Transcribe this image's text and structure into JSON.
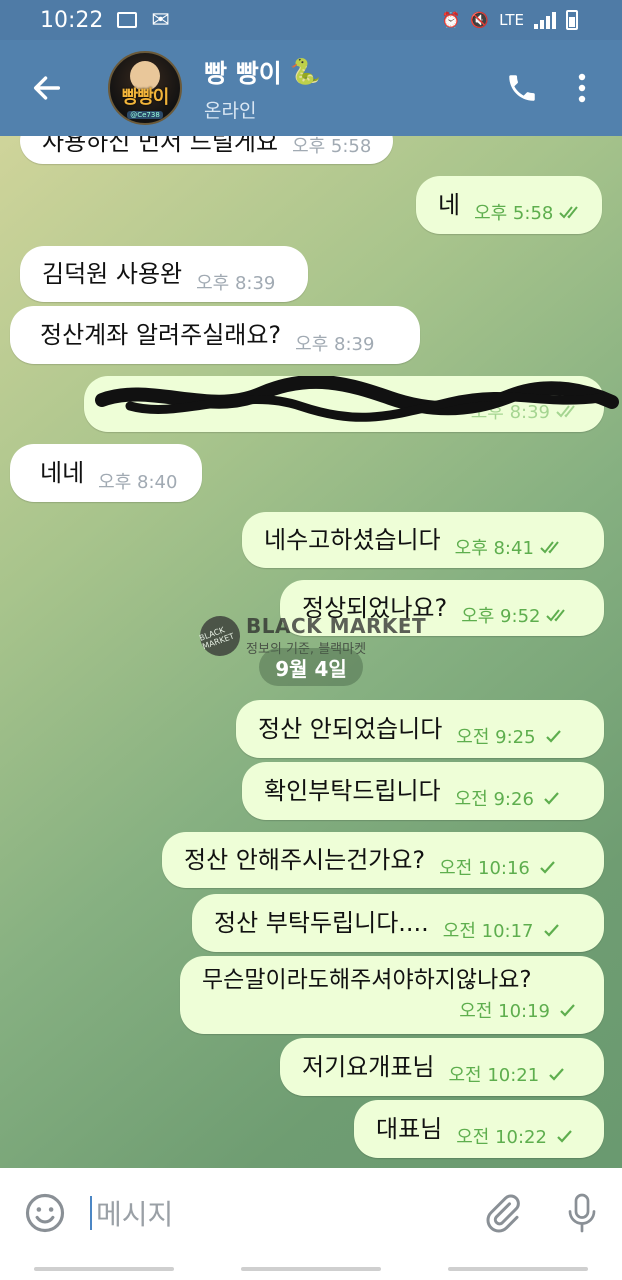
{
  "status_bar": {
    "time": "10:22",
    "network": "LTE"
  },
  "header": {
    "title": "빵 빵이",
    "title_emoji": "🐍",
    "subtitle": "온라인",
    "avatar_text": "빵빵이",
    "avatar_tag": "@Ce738"
  },
  "messages": [
    {
      "dir": "in",
      "text": "사용하신 먼저 드릴게요",
      "time": "오후 5:58",
      "checks": 0
    },
    {
      "dir": "out",
      "text": "네",
      "time": "오후 5:58",
      "checks": 2
    },
    {
      "dir": "in",
      "text": "김덕원 사용완",
      "time": "오후 8:39",
      "checks": 0
    },
    {
      "dir": "in",
      "text": "정산계좌 알려주실래요?",
      "time": "오후 8:39",
      "checks": 0
    },
    {
      "dir": "out",
      "text": "",
      "time": "오후 8:39",
      "checks": 2,
      "redacted": true
    },
    {
      "dir": "in",
      "text": "네네",
      "time": "오후 8:40",
      "checks": 0
    },
    {
      "dir": "out",
      "text": "네수고하셨습니다",
      "time": "오후 8:41",
      "checks": 2
    },
    {
      "dir": "out",
      "text": "정상되었나요?",
      "time": "오후 9:52",
      "checks": 2
    },
    {
      "dir": "out",
      "text": "정산 안되었습니다",
      "time": "오전 9:25",
      "checks": 1
    },
    {
      "dir": "out",
      "text": "확인부탁드립니다",
      "time": "오전 9:26",
      "checks": 1
    },
    {
      "dir": "out",
      "text": "정산 안해주시는건가요?",
      "time": "오전 10:16",
      "checks": 1
    },
    {
      "dir": "out",
      "text": "정산 부탁두립니다....",
      "time": "오전 10:17",
      "checks": 1
    },
    {
      "dir": "out",
      "text": "무슨말이라도해주셔야하지않나요?",
      "time": "오전 10:19",
      "checks": 1
    },
    {
      "dir": "out",
      "text": "저기요개표님",
      "time": "오전 10:21",
      "checks": 1
    },
    {
      "dir": "out",
      "text": "대표님",
      "time": "오전 10:22",
      "checks": 1
    }
  ],
  "date_divider": "9월 4일",
  "watermark": {
    "logo": "BLACK MARKET",
    "title": "BLACK MARKET",
    "subtitle": "정보의 기준, 블랙마켓"
  },
  "input": {
    "placeholder": "메시지"
  },
  "colors": {
    "header": "#5281ad",
    "status_bar": "#4f7ba6",
    "bubble_in": "#ffffff",
    "bubble_out": "#eefed7",
    "check": "#5eae4e"
  }
}
